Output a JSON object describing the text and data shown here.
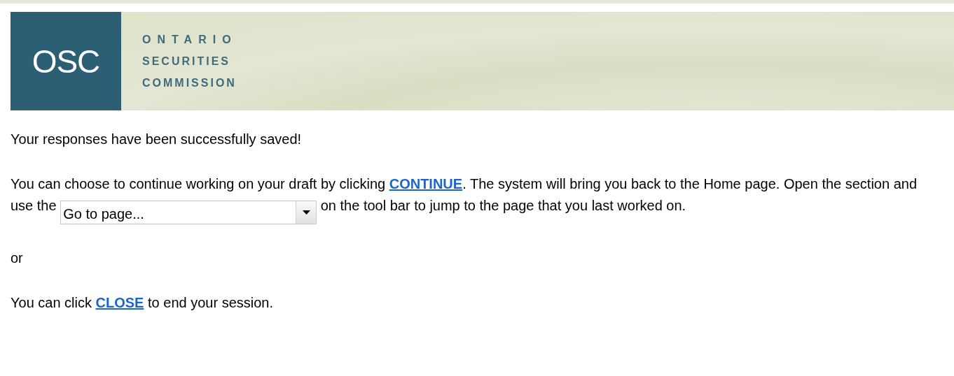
{
  "header": {
    "logo_mark": "OSC",
    "logo_lines": [
      "ONTARIO",
      "SECURITIES",
      "COMMISSION"
    ]
  },
  "message": "Your responses have been successfully saved!",
  "continue_paragraph": {
    "before_link": "You can choose to continue working on your draft by clicking",
    "link": "CONTINUE",
    "after_link": ". The system will bring you back to the Home page. Open the section and use the",
    "dropdown": {
      "value": "Go to page..."
    },
    "after_dropdown": "on the tool bar to jump to the page that you last worked on."
  },
  "separator": "or",
  "close_paragraph": {
    "before_link": "You can click",
    "link": "CLOSE",
    "after_link": "to end your session."
  }
}
